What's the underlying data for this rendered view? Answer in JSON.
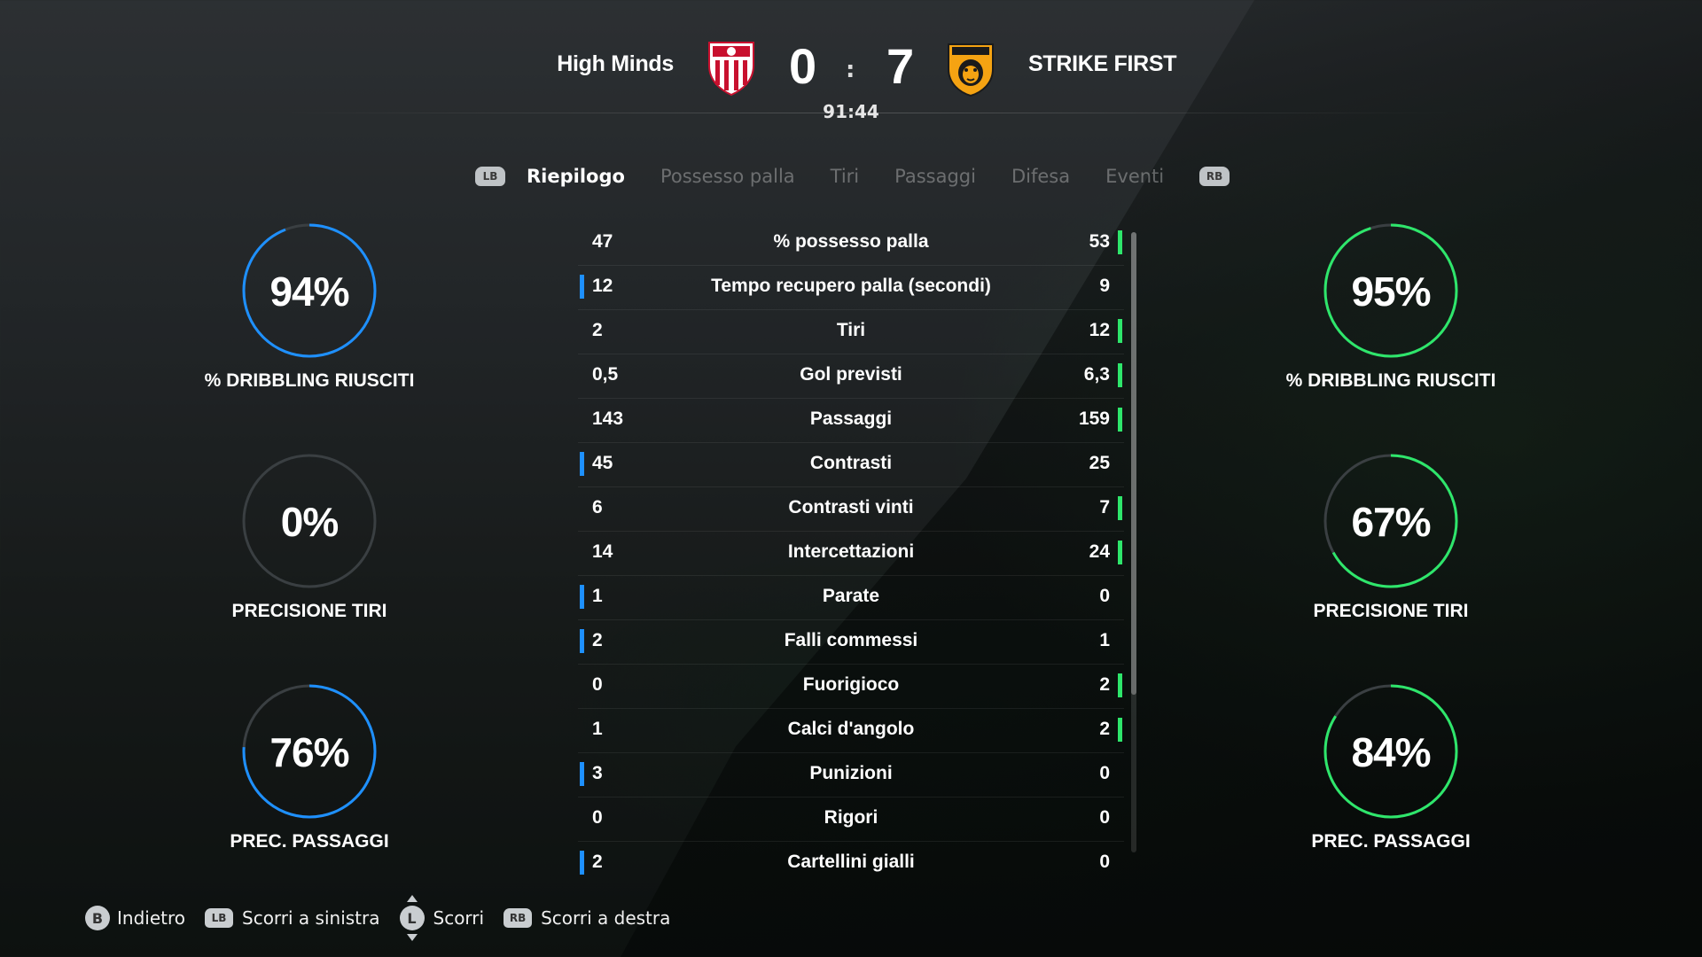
{
  "match": {
    "home_team": "High Minds",
    "away_team": "STRIKE FIRST",
    "home_score": "0",
    "away_score": "7",
    "separator": ":",
    "clock": "91:44",
    "home_crest_icon": "sevilla-crest-icon",
    "away_crest_icon": "hull-city-crest-icon"
  },
  "tabs": {
    "left_shoulder": "LB",
    "right_shoulder": "RB",
    "items": [
      {
        "label": "Riepilogo",
        "active": true
      },
      {
        "label": "Possesso palla",
        "active": false
      },
      {
        "label": "Tiri",
        "active": false
      },
      {
        "label": "Passaggi",
        "active": false
      },
      {
        "label": "Difesa",
        "active": false
      },
      {
        "label": "Eventi",
        "active": false
      }
    ]
  },
  "stats": [
    {
      "label": "% possesso palla",
      "home": "47",
      "away": "53",
      "leader": "away"
    },
    {
      "label": "Tempo recupero palla (secondi)",
      "home": "12",
      "away": "9",
      "leader": "home"
    },
    {
      "label": "Tiri",
      "home": "2",
      "away": "12",
      "leader": "away"
    },
    {
      "label": "Gol previsti",
      "home": "0,5",
      "away": "6,3",
      "leader": "away"
    },
    {
      "label": "Passaggi",
      "home": "143",
      "away": "159",
      "leader": "away"
    },
    {
      "label": "Contrasti",
      "home": "45",
      "away": "25",
      "leader": "home"
    },
    {
      "label": "Contrasti vinti",
      "home": "6",
      "away": "7",
      "leader": "away"
    },
    {
      "label": "Intercettazioni",
      "home": "14",
      "away": "24",
      "leader": "away"
    },
    {
      "label": "Parate",
      "home": "1",
      "away": "0",
      "leader": "home"
    },
    {
      "label": "Falli commessi",
      "home": "2",
      "away": "1",
      "leader": "home"
    },
    {
      "label": "Fuorigioco",
      "home": "0",
      "away": "2",
      "leader": "away"
    },
    {
      "label": "Calci d'angolo",
      "home": "1",
      "away": "2",
      "leader": "away"
    },
    {
      "label": "Punizioni",
      "home": "3",
      "away": "0",
      "leader": "home"
    },
    {
      "label": "Rigori",
      "home": "0",
      "away": "0",
      "leader": "none"
    },
    {
      "label": "Cartellini gialli",
      "home": "2",
      "away": "0",
      "leader": "home"
    }
  ],
  "gauges": {
    "home": [
      {
        "value": "94%",
        "fraction": 0.94,
        "label": "% DRIBBLING RIUSCITI"
      },
      {
        "value": "0%",
        "fraction": 0.0,
        "label": "PRECISIONE TIRI"
      },
      {
        "value": "76%",
        "fraction": 0.76,
        "label": "PREC. PASSAGGI"
      }
    ],
    "away": [
      {
        "value": "95%",
        "fraction": 0.95,
        "label": "% DRIBBLING RIUSCITI"
      },
      {
        "value": "67%",
        "fraction": 0.67,
        "label": "PRECISIONE TIRI"
      },
      {
        "value": "84%",
        "fraction": 0.84,
        "label": "PREC. PASSAGGI"
      }
    ]
  },
  "footer": {
    "back_button": "B",
    "back_label": "Indietro",
    "scroll_left_button": "LB",
    "scroll_left_label": "Scorri a sinistra",
    "scroll_button": "L",
    "scroll_label": "Scorri",
    "scroll_right_button": "RB",
    "scroll_right_label": "Scorri a destra"
  },
  "colors": {
    "home_accent": "#1e90ff",
    "away_accent": "#2ee66b",
    "track": "#3a3f42"
  }
}
